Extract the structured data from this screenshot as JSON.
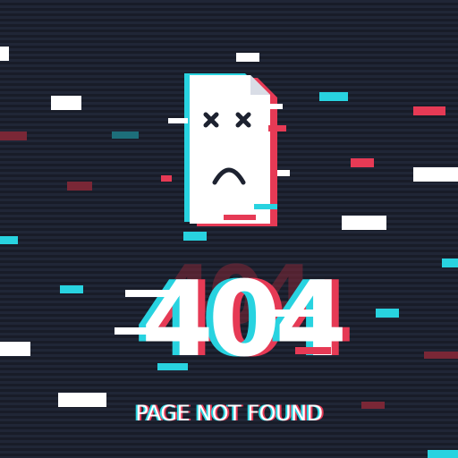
{
  "error": {
    "code": "404",
    "message": "PAGE NOT FOUND",
    "icon": "sad-document-icon"
  },
  "colors": {
    "background": "#1d2230",
    "white": "#ffffff",
    "cyan": "#28d3e0",
    "red": "#e63a55"
  }
}
